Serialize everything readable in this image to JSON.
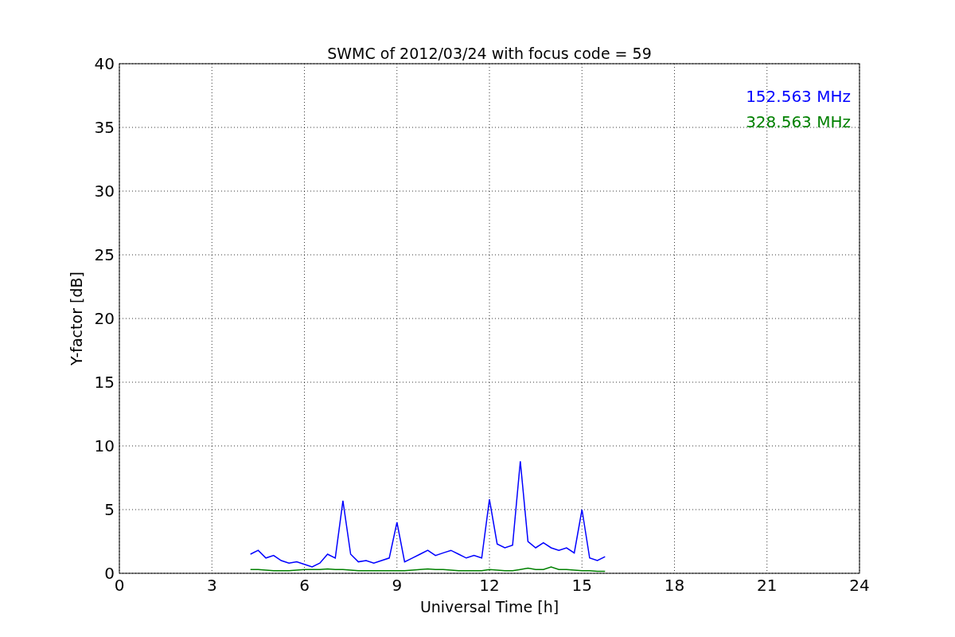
{
  "chart_data": {
    "type": "line",
    "title": "SWMC of 2012/03/24 with focus code = 59",
    "xlabel": "Universal Time [h]",
    "ylabel": "Y-factor [dB]",
    "xlim": [
      0,
      24
    ],
    "ylim": [
      0,
      40
    ],
    "xticks": [
      0,
      3,
      6,
      9,
      12,
      15,
      18,
      21,
      24
    ],
    "yticks": [
      0,
      5,
      10,
      15,
      20,
      25,
      30,
      35,
      40
    ],
    "grid": true,
    "x": [
      4.25,
      4.5,
      4.75,
      5.0,
      5.25,
      5.5,
      5.75,
      6.0,
      6.25,
      6.5,
      6.75,
      7.0,
      7.25,
      7.5,
      7.75,
      8.0,
      8.25,
      8.5,
      8.75,
      9.0,
      9.25,
      9.5,
      9.75,
      10.0,
      10.25,
      10.5,
      10.75,
      11.0,
      11.25,
      11.5,
      11.75,
      12.0,
      12.25,
      12.5,
      12.75,
      13.0,
      13.25,
      13.5,
      13.75,
      14.0,
      14.25,
      14.5,
      14.75,
      15.0,
      15.25,
      15.5,
      15.75
    ],
    "series": [
      {
        "name": "152.563 MHz",
        "color": "#0000ff",
        "values": [
          1.5,
          1.8,
          1.2,
          1.4,
          1.0,
          0.8,
          0.9,
          0.7,
          0.5,
          0.8,
          1.5,
          1.2,
          5.7,
          1.5,
          0.9,
          1.0,
          0.8,
          1.0,
          1.2,
          4.0,
          0.9,
          1.2,
          1.5,
          1.8,
          1.4,
          1.6,
          1.8,
          1.5,
          1.2,
          1.4,
          1.2,
          5.8,
          2.3,
          2.0,
          2.2,
          8.8,
          2.5,
          2.0,
          2.4,
          2.0,
          1.8,
          2.0,
          1.6,
          5.0,
          1.2,
          1.0,
          1.3
        ]
      },
      {
        "name": "328.563 MHz",
        "color": "#008000",
        "values": [
          0.3,
          0.3,
          0.25,
          0.2,
          0.2,
          0.2,
          0.25,
          0.3,
          0.3,
          0.3,
          0.35,
          0.3,
          0.3,
          0.25,
          0.2,
          0.2,
          0.2,
          0.2,
          0.2,
          0.2,
          0.2,
          0.25,
          0.3,
          0.35,
          0.3,
          0.3,
          0.25,
          0.2,
          0.2,
          0.2,
          0.2,
          0.3,
          0.25,
          0.2,
          0.2,
          0.3,
          0.4,
          0.3,
          0.3,
          0.5,
          0.3,
          0.3,
          0.25,
          0.2,
          0.2,
          0.15,
          0.15
        ]
      }
    ]
  }
}
